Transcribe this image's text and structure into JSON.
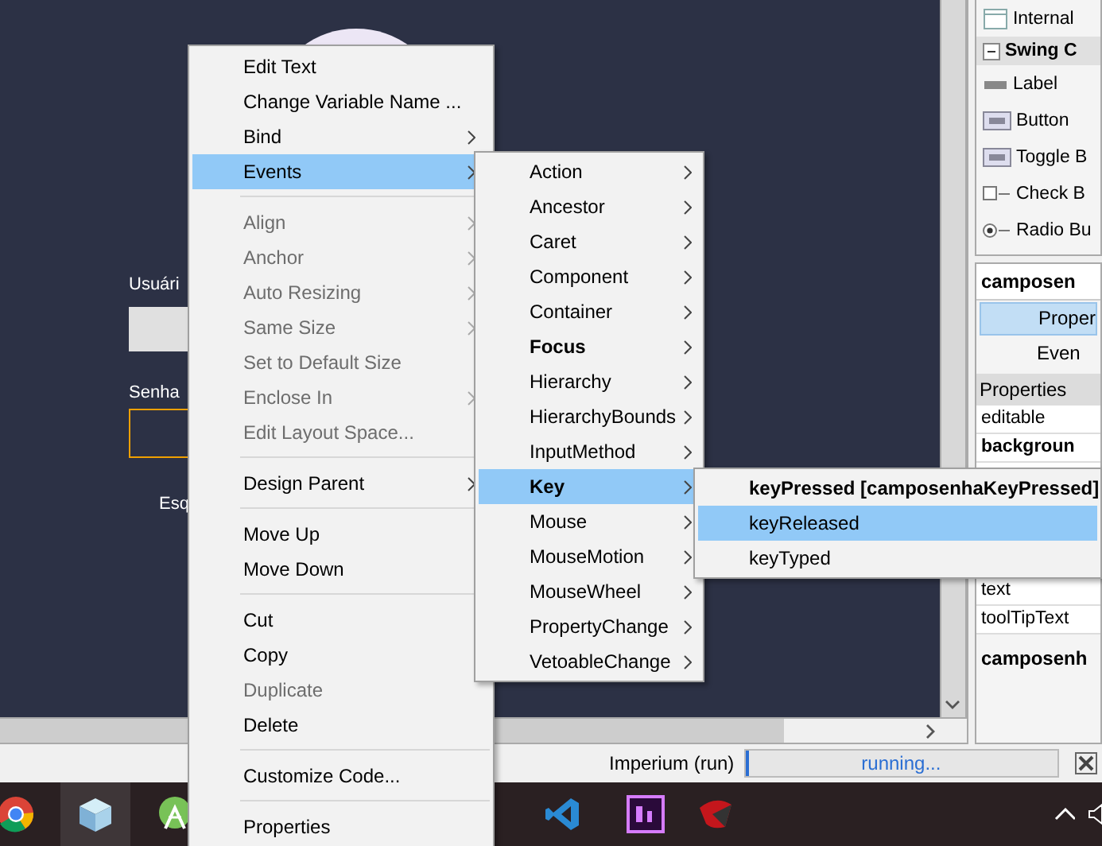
{
  "canvas": {
    "labels": [
      {
        "text": "Usuári"
      },
      {
        "text": "Senha"
      },
      {
        "text": "Esq"
      }
    ]
  },
  "palette": {
    "items": [
      {
        "label": "Internal",
        "kind": "frame"
      },
      {
        "label": "Swing C",
        "kind": "header"
      },
      {
        "label": "Label",
        "kind": "label"
      },
      {
        "label": "Button",
        "kind": "button"
      },
      {
        "label": "Toggle B",
        "kind": "toggle"
      },
      {
        "label": "Check B",
        "kind": "check"
      },
      {
        "label": "Radio Bu",
        "kind": "radio"
      }
    ]
  },
  "inspector": {
    "title": "camposen",
    "tabs": [
      {
        "label": "Proper",
        "selected": true
      },
      {
        "label": "Even",
        "selected": false
      }
    ],
    "section": "Properties",
    "rows": [
      {
        "name": "editable",
        "bold": false
      },
      {
        "name": "backgroun",
        "bold": true
      },
      {
        "name": "text",
        "bold": false
      },
      {
        "name": "toolTipText",
        "bold": false
      }
    ],
    "footer": "camposenh"
  },
  "status_bar": {
    "project": "Imperium (run)",
    "progress": "running...",
    "level": 0.01
  },
  "taskbar": {
    "icons": [
      {
        "kind": "chrome",
        "selected": false
      },
      {
        "kind": "cube",
        "selected": true
      },
      {
        "kind": "android",
        "selected": false
      },
      {
        "kind": "code",
        "selected": false
      },
      {
        "kind": "premiere",
        "selected": false
      },
      {
        "kind": "red",
        "selected": false
      }
    ]
  },
  "context_menu": {
    "items": [
      {
        "kind": "item",
        "label": "Edit Text",
        "disabled": false,
        "submenu": false,
        "selected": false
      },
      {
        "kind": "item",
        "label": "Change Variable Name ...",
        "disabled": false,
        "submenu": false,
        "selected": false
      },
      {
        "kind": "item",
        "label": "Bind",
        "disabled": false,
        "submenu": true,
        "selected": false
      },
      {
        "kind": "item",
        "label": "Events",
        "disabled": false,
        "submenu": true,
        "selected": true
      },
      {
        "kind": "separator"
      },
      {
        "kind": "item",
        "label": "Align",
        "disabled": true,
        "submenu": true,
        "selected": false
      },
      {
        "kind": "item",
        "label": "Anchor",
        "disabled": true,
        "submenu": true,
        "selected": false
      },
      {
        "kind": "item",
        "label": "Auto Resizing",
        "disabled": true,
        "submenu": true,
        "selected": false
      },
      {
        "kind": "item",
        "label": "Same Size",
        "disabled": true,
        "submenu": true,
        "selected": false
      },
      {
        "kind": "item",
        "label": "Set to Default Size",
        "disabled": true,
        "submenu": false,
        "selected": false
      },
      {
        "kind": "item",
        "label": "Enclose In",
        "disabled": true,
        "submenu": true,
        "selected": false
      },
      {
        "kind": "item",
        "label": "Edit Layout Space...",
        "disabled": true,
        "submenu": false,
        "selected": false
      },
      {
        "kind": "separator"
      },
      {
        "kind": "item",
        "label": "Design Parent",
        "disabled": false,
        "submenu": true,
        "selected": false
      },
      {
        "kind": "separator"
      },
      {
        "kind": "item",
        "label": "Move Up",
        "disabled": false,
        "submenu": false,
        "selected": false
      },
      {
        "kind": "item",
        "label": "Move Down",
        "disabled": false,
        "submenu": false,
        "selected": false
      },
      {
        "kind": "separator"
      },
      {
        "kind": "item",
        "label": "Cut",
        "disabled": false,
        "submenu": false,
        "selected": false
      },
      {
        "kind": "item",
        "label": "Copy",
        "disabled": false,
        "submenu": false,
        "selected": false
      },
      {
        "kind": "item",
        "label": "Duplicate",
        "disabled": true,
        "submenu": false,
        "selected": false
      },
      {
        "kind": "item",
        "label": "Delete",
        "disabled": false,
        "submenu": false,
        "selected": false
      },
      {
        "kind": "separator"
      },
      {
        "kind": "item",
        "label": "Customize Code...",
        "disabled": false,
        "submenu": false,
        "selected": false
      },
      {
        "kind": "separator"
      },
      {
        "kind": "item",
        "label": "Properties",
        "disabled": false,
        "submenu": false,
        "selected": false
      }
    ]
  },
  "events_menu": {
    "items": [
      {
        "label": "Action",
        "bold": false,
        "selected": false
      },
      {
        "label": "Ancestor",
        "bold": false,
        "selected": false
      },
      {
        "label": "Caret",
        "bold": false,
        "selected": false
      },
      {
        "label": "Component",
        "bold": false,
        "selected": false
      },
      {
        "label": "Container",
        "bold": false,
        "selected": false
      },
      {
        "label": "Focus",
        "bold": true,
        "selected": false
      },
      {
        "label": "Hierarchy",
        "bold": false,
        "selected": false
      },
      {
        "label": "HierarchyBounds",
        "bold": false,
        "selected": false
      },
      {
        "label": "InputMethod",
        "bold": false,
        "selected": false
      },
      {
        "label": "Key",
        "bold": true,
        "selected": true
      },
      {
        "label": "Mouse",
        "bold": false,
        "selected": false
      },
      {
        "label": "MouseMotion",
        "bold": false,
        "selected": false
      },
      {
        "label": "MouseWheel",
        "bold": false,
        "selected": false
      },
      {
        "label": "PropertyChange",
        "bold": false,
        "selected": false
      },
      {
        "label": "VetoableChange",
        "bold": false,
        "selected": false
      }
    ]
  },
  "key_menu": {
    "items": [
      {
        "label": "keyPressed [camposenhaKeyPressed]",
        "bold": true,
        "selected": false
      },
      {
        "label": "keyReleased",
        "bold": false,
        "selected": true
      },
      {
        "label": "keyTyped",
        "bold": false,
        "selected": false
      }
    ]
  }
}
